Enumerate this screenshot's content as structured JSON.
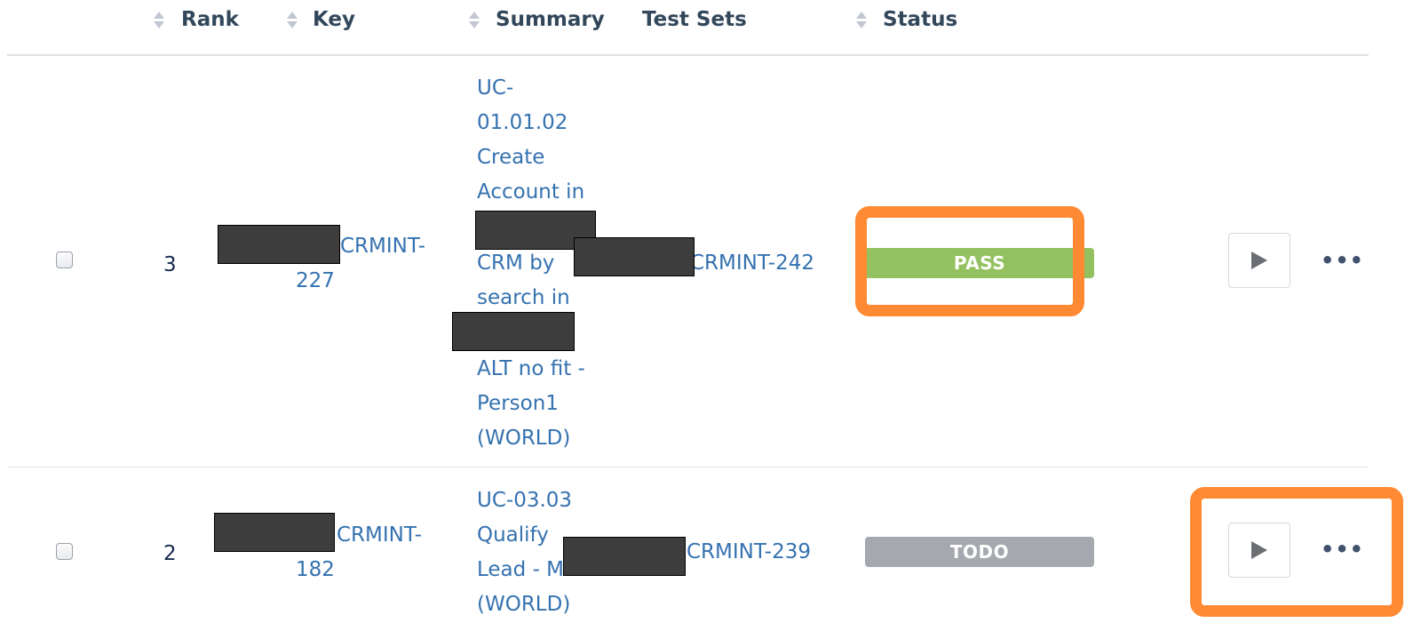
{
  "columns": {
    "rank": "Rank",
    "key": "Key",
    "summary": "Summary",
    "test_sets": "Test Sets",
    "status": "Status"
  },
  "rows": [
    {
      "rank": "3",
      "key_part1": "CRMINT-",
      "key_part2": "227",
      "summary_lines": [
        "UC-",
        "01.01.02",
        "Create",
        "Account in",
        "CRM by",
        "search in",
        "ALT no fit -",
        "Person1",
        "(WORLD)"
      ],
      "test_set": "CRMINT-242",
      "status": "PASS",
      "status_color": "#94c160"
    },
    {
      "rank": "2",
      "key_part1": "CRMINT-",
      "key_part2": "182",
      "summary_lines": [
        "UC-03.03",
        "Qualify",
        "Lead - MIN",
        "(WORLD)"
      ],
      "test_set": "CRMINT-239",
      "status": "TODO",
      "status_color": "#a5a8ae"
    }
  ],
  "icons": {
    "sort": "sort-arrows-icon",
    "run": "play-icon",
    "more": "ellipsis-icon"
  },
  "more_glyph": "•••",
  "highlight_color": "#ff8a33"
}
